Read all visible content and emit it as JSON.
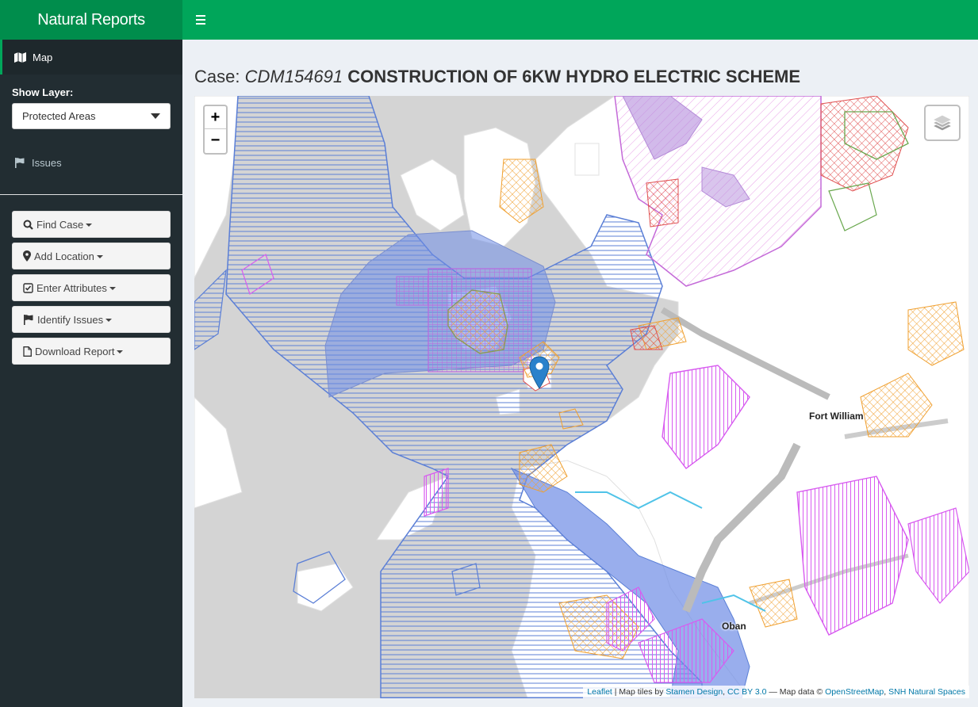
{
  "app": {
    "brand": "Natural Reports"
  },
  "sidebar": {
    "map_label": "Map",
    "show_layer_label": "Show Layer:",
    "layer_select": {
      "selected": "Protected Areas"
    },
    "issues_label": "Issues",
    "buttons": [
      {
        "label": "Find Case",
        "icon": "search-icon"
      },
      {
        "label": "Add Location",
        "icon": "map-marker-icon"
      },
      {
        "label": "Enter Attributes",
        "icon": "check-square-icon"
      },
      {
        "label": "Identify Issues",
        "icon": "flag-icon"
      },
      {
        "label": "Download Report",
        "icon": "file-icon"
      }
    ]
  },
  "case": {
    "prefix": "Case:",
    "id": "CDM154691",
    "description": "CONSTRUCTION OF 6KW HYDRO ELECTRIC SCHEME"
  },
  "map": {
    "zoom_in": "+",
    "zoom_out": "−",
    "places": [
      "Fort William",
      "Oban"
    ],
    "attribution": {
      "leaflet": "Leaflet",
      "tiles_by": "| Map tiles by",
      "stamen": "Stamen Design",
      "comma": ",",
      "license": "CC BY 3.0",
      "data_text": "— Map data ©",
      "osm": "OpenStreetMap",
      "snh": "SNH Natural Spaces"
    },
    "colors": {
      "sea": "#d4d4d4",
      "land": "#ffffff",
      "marine_protected": "#5b7fd6",
      "sac_hatch": "#d85bf0",
      "sssi": "#f0a030",
      "spa": "#b48ad8",
      "marker": "#2a81cb"
    }
  }
}
